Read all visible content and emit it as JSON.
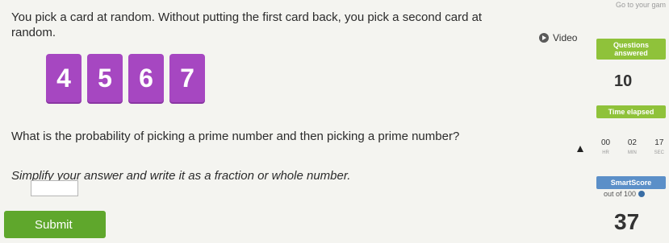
{
  "top_link": "Go to your gam",
  "question": {
    "text": "You pick a card at random. Without putting the first card back, you pick a second card at random.",
    "cards": [
      "4",
      "5",
      "6",
      "7"
    ],
    "probability_question": "What is the probability of picking a prime number and then picking a prime number?",
    "instruction": "Simplify your answer and write it as a fraction or whole number.",
    "answer_value": ""
  },
  "submit_label": "Submit",
  "sidebar": {
    "video_label": "Video",
    "questions_answered_label": "Questions answered",
    "questions_answered_value": "10",
    "time_elapsed_label": "Time elapsed",
    "timer": {
      "hr": "00",
      "min": "02",
      "sec": "17",
      "hr_label": "HR",
      "min_label": "MIN",
      "sec_label": "SEC"
    },
    "smartscore_label": "SmartScore",
    "smartscore_subtext": "out of 100",
    "smartscore_value": "37"
  },
  "colors": {
    "card": "#a647c1",
    "submit": "#5fa72c",
    "label": "#8fc23a",
    "score_label": "#5b8fc8"
  }
}
